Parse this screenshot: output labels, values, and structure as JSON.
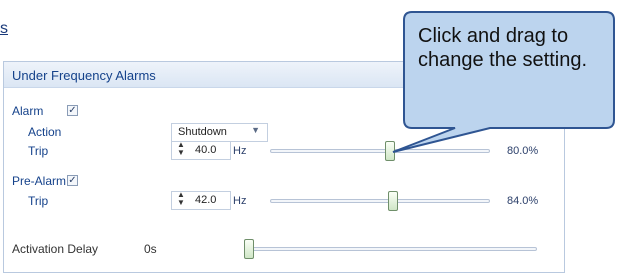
{
  "page": {
    "title_fragment": "s"
  },
  "panel": {
    "title": "Under Frequency Alarms",
    "alarm": {
      "label": "Alarm",
      "checked_glyph": "✓",
      "action_label": "Action",
      "action_value": "Shutdown",
      "trip_label": "Trip",
      "trip_value": "40.0",
      "trip_unit": "Hz",
      "trip_percent": "80.0%",
      "slider_fraction": 0.8
    },
    "pre_alarm": {
      "label": "Pre-Alarm",
      "checked_glyph": "✓",
      "trip_label": "Trip",
      "trip_value": "42.0",
      "trip_unit": "Hz",
      "trip_percent": "84.0%",
      "slider_fraction": 0.84
    },
    "activation_delay": {
      "label": "Activation Delay",
      "value": "0s",
      "slider_fraction": 0
    }
  },
  "callout": {
    "text": "Click and drag to change the setting.",
    "fill": "#bcd4ee",
    "border": "#2f5592"
  },
  "colors": {
    "label": "#15428b",
    "panel_border": "#b9c9df"
  },
  "icons": {
    "spinner": "up-down-arrows-icon",
    "dropdown": "chevron-down-icon",
    "check": "check-icon"
  }
}
